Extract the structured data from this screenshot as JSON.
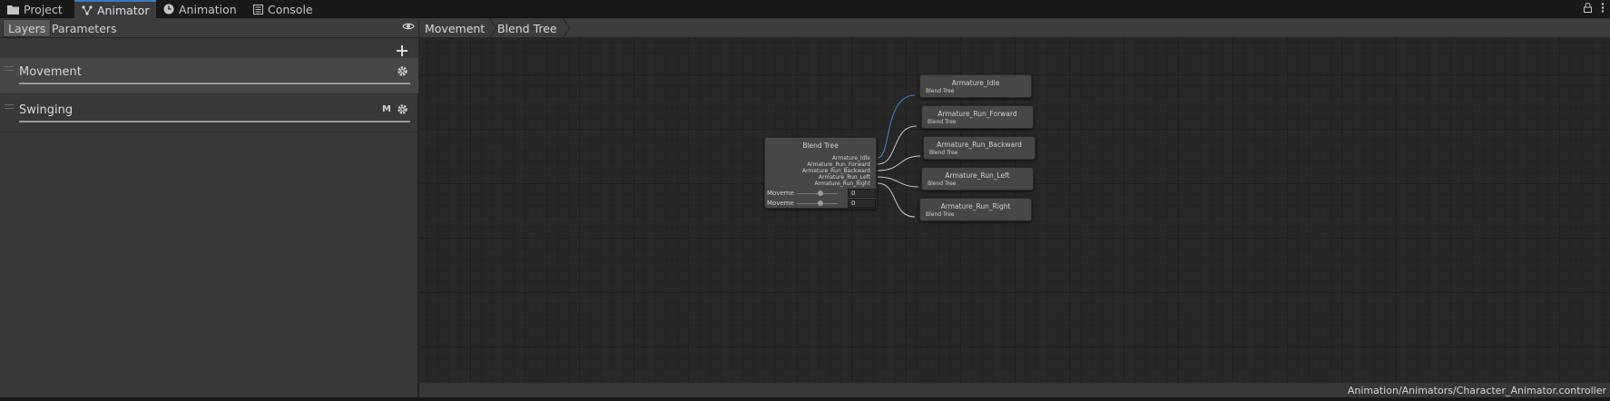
{
  "tabs": [
    {
      "label": "Project",
      "icon": "folder-icon"
    },
    {
      "label": "Animator",
      "icon": "animator-icon"
    },
    {
      "label": "Animation",
      "icon": "clock-icon"
    },
    {
      "label": "Console",
      "icon": "console-icon"
    }
  ],
  "left_panel": {
    "subtabs": [
      "Layers",
      "Parameters"
    ],
    "layers": [
      {
        "name": "Movement",
        "mute_tag": ""
      },
      {
        "name": "Swinging",
        "mute_tag": "M"
      }
    ]
  },
  "breadcrumb": [
    "Movement",
    "Blend Tree"
  ],
  "blend_tree": {
    "title": "Blend Tree",
    "outputs": [
      "Armature_Idle",
      "Armature_Run_Forward",
      "Armature_Run_Backward",
      "Armature_Run_Left",
      "Armature_Run_Right"
    ],
    "params": [
      {
        "label": "Moveme",
        "value": "0"
      },
      {
        "label": "Moveme",
        "value": "0"
      }
    ]
  },
  "clip_nodes": [
    {
      "title": "Armature_Idle",
      "subtitle": "Blend Tree"
    },
    {
      "title": "Armature_Run_Forward",
      "subtitle": "Blend Tree"
    },
    {
      "title": "Armature_Run_Backward",
      "subtitle": "Blend Tree"
    },
    {
      "title": "Armature_Run_Left",
      "subtitle": "Blend Tree"
    },
    {
      "title": "Armature_Run_Right",
      "subtitle": "Blend Tree"
    }
  ],
  "status": {
    "path": "Animation/Animators/Character_Animator.controller"
  },
  "colors": {
    "accent": "#3a79bb",
    "wire": "#c8c8c8",
    "wire_active": "#4a86c8"
  }
}
